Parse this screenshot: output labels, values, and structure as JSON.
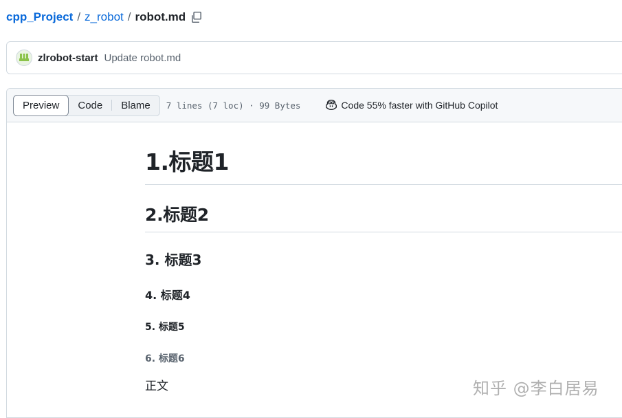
{
  "breadcrumb": {
    "repo": "cpp_Project",
    "separator": "/",
    "folder": "z_robot",
    "file": "robot.md"
  },
  "commit": {
    "author": "zlrobot-start",
    "message": "Update robot.md"
  },
  "file_header": {
    "tabs": [
      {
        "label": "Preview",
        "active": true
      },
      {
        "label": "Code",
        "active": false
      },
      {
        "label": "Blame",
        "active": false
      }
    ],
    "meta": "7 lines (7 loc) · 99 Bytes",
    "copilot_label": "Code 55% faster with GitHub Copilot"
  },
  "markdown": {
    "h1": "1.标题1",
    "h2": "2.标题2",
    "h3": "3. 标题3",
    "h4": "4. 标题4",
    "h5": "5. 标题5",
    "h6": "6. 标题6",
    "body": "正文"
  },
  "watermark": "知乎 @李白居易",
  "colors": {
    "link": "#0969da",
    "muted": "#59636e",
    "border": "#d1d9e0",
    "header_bg": "#f6f8fa"
  },
  "icons": [
    "copy-icon",
    "avatar",
    "copilot-icon"
  ]
}
